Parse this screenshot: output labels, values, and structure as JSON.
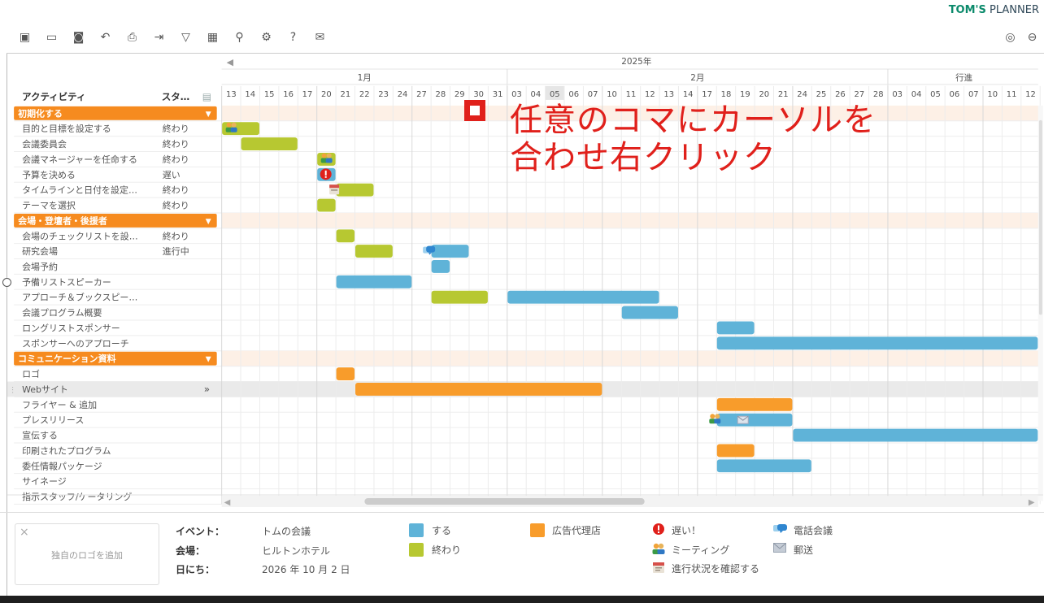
{
  "brand": {
    "bold": "TOM'S",
    "rest": " PLANNER"
  },
  "toolbar": {
    "icons": [
      "new-file-icon",
      "folder-icon",
      "save-icon",
      "undo-icon",
      "print-icon",
      "export-icon",
      "filter-icon",
      "calendar-view-icon",
      "search-icon",
      "settings-icon",
      "help-icon",
      "mail-icon"
    ],
    "glyphs": [
      "▣",
      "▭",
      "◙",
      "↶",
      "⎙",
      "⇥",
      "▽",
      "▦",
      "⚲",
      "⚙",
      "?",
      "✉"
    ],
    "right_icons": [
      "user-icon",
      "logout-icon"
    ],
    "right_glyphs": [
      "◎",
      "⊖"
    ]
  },
  "header": {
    "activity_label": "アクティビティ",
    "status_label": "スタ…",
    "year": "2025年",
    "months": [
      "1月",
      "2月",
      "行進"
    ],
    "days": [
      "13",
      "14",
      "15",
      "16",
      "17",
      "20",
      "21",
      "22",
      "23",
      "24",
      "27",
      "28",
      "29",
      "30",
      "31",
      "03",
      "04",
      "05",
      "06",
      "07",
      "10",
      "11",
      "12",
      "13",
      "14",
      "17",
      "18",
      "19",
      "20",
      "21",
      "24",
      "25",
      "26",
      "27",
      "28",
      "03",
      "04",
      "05",
      "06",
      "07",
      "10",
      "11",
      "12"
    ],
    "highlight_day_index": 17
  },
  "colors": {
    "orange": "#f89c2b",
    "green": "#b7c831",
    "blue": "#5fb3d8",
    "group_bg": "#f68b1f",
    "red": "#e0201b"
  },
  "rows": [
    {
      "type": "group",
      "label": "初期化する"
    },
    {
      "type": "task",
      "label": "目的と目標を設定する",
      "status": "終わり",
      "bars": [
        {
          "start": 0,
          "len": 2,
          "color": "green",
          "icon": "meeting"
        }
      ]
    },
    {
      "type": "task",
      "label": "会議委員会",
      "status": "終わり",
      "bars": [
        {
          "start": 1,
          "len": 3,
          "color": "green"
        }
      ]
    },
    {
      "type": "task",
      "label": "会議マネージャーを任命する",
      "status": "終わり",
      "bars": [
        {
          "start": 5,
          "len": 1,
          "color": "green",
          "icon": "meeting"
        }
      ]
    },
    {
      "type": "task",
      "label": "予算を決める",
      "status": "遅い",
      "bars": [
        {
          "start": 5,
          "len": 1,
          "color": "blue",
          "icon": "late"
        }
      ]
    },
    {
      "type": "task",
      "label": "タイムラインと日付を設定…",
      "status": "終わり",
      "bars": [
        {
          "start": 6,
          "len": 2,
          "color": "green",
          "icon": "progress"
        }
      ]
    },
    {
      "type": "task",
      "label": "テーマを選択",
      "status": "終わり",
      "bars": [
        {
          "start": 5,
          "len": 1,
          "color": "green"
        }
      ]
    },
    {
      "type": "group",
      "label": "会場・登壇者・後援者"
    },
    {
      "type": "task",
      "label": "会場のチェックリストを設…",
      "status": "終わり",
      "bars": [
        {
          "start": 6,
          "len": 1,
          "color": "green"
        }
      ]
    },
    {
      "type": "task",
      "label": "研究会場",
      "status": "進行中",
      "bars": [
        {
          "start": 7,
          "len": 2,
          "color": "green"
        },
        {
          "start": 11,
          "len": 2,
          "color": "blue",
          "icon": "call"
        }
      ]
    },
    {
      "type": "task",
      "label": "会場予約",
      "status": "",
      "bars": [
        {
          "start": 11,
          "len": 1,
          "color": "blue"
        }
      ]
    },
    {
      "type": "task",
      "label": "予備リストスピーカー",
      "status": "",
      "bars": [
        {
          "start": 6,
          "len": 4,
          "color": "blue"
        }
      ]
    },
    {
      "type": "task",
      "label": "アプローチ＆ブックスピー…",
      "status": "",
      "bars": [
        {
          "start": 11,
          "len": 3,
          "color": "green"
        },
        {
          "start": 15,
          "len": 8,
          "color": "blue"
        }
      ]
    },
    {
      "type": "task",
      "label": "会議プログラム概要",
      "status": "",
      "bars": [
        {
          "start": 21,
          "len": 3,
          "color": "blue"
        }
      ]
    },
    {
      "type": "task",
      "label": "ロングリストスポンサー",
      "status": "",
      "bars": [
        {
          "start": 26,
          "len": 2,
          "color": "blue"
        }
      ]
    },
    {
      "type": "task",
      "label": "スポンサーへのアプローチ",
      "status": "",
      "bars": [
        {
          "start": 26,
          "len": 17,
          "color": "blue"
        }
      ]
    },
    {
      "type": "group",
      "label": "コミュニケーション資料"
    },
    {
      "type": "task",
      "label": "ロゴ",
      "status": "",
      "bars": [
        {
          "start": 6,
          "len": 1,
          "color": "orange"
        }
      ]
    },
    {
      "type": "task",
      "label": "Webサイト",
      "status": "",
      "selected": true,
      "more": "»",
      "bars": [
        {
          "start": 7,
          "len": 13,
          "color": "orange"
        }
      ]
    },
    {
      "type": "task",
      "label": "フライヤー & 追加",
      "status": "",
      "bars": [
        {
          "start": 26,
          "len": 4,
          "color": "orange"
        }
      ]
    },
    {
      "type": "task",
      "label": "プレスリリース",
      "status": "",
      "bars": [
        {
          "start": 26,
          "len": 4,
          "color": "blue",
          "icon": "meeting-mail"
        }
      ]
    },
    {
      "type": "task",
      "label": "宣伝する",
      "status": "",
      "bars": [
        {
          "start": 30,
          "len": 13,
          "color": "blue"
        }
      ]
    },
    {
      "type": "task",
      "label": "印刷されたプログラム",
      "status": "",
      "bars": [
        {
          "start": 26,
          "len": 2,
          "color": "orange"
        }
      ]
    },
    {
      "type": "task",
      "label": "委任情報パッケージ",
      "status": "",
      "bars": [
        {
          "start": 26,
          "len": 5,
          "color": "blue"
        }
      ]
    },
    {
      "type": "task",
      "label": "サイネージ",
      "status": "",
      "bars": []
    },
    {
      "type": "task",
      "label": "指示スタッフ/ケータリング",
      "status": "",
      "bars": []
    }
  ],
  "annotation": {
    "line1": "任意のコマにカーソルを",
    "line2": "合わせ右クリック"
  },
  "legend": {
    "logo_close": "×",
    "logo_text": "独自のロゴを追加",
    "event_key": "イベント：",
    "event_value": "トムの会議",
    "venue_key": "会場：",
    "venue_value": "ヒルトンホテル",
    "date_key": "日にち：",
    "date_value": "2026 年 10 月 2 日",
    "do_label": "する",
    "done_label": "終わり",
    "agency_label": "広告代理店",
    "late_label": "遅い！",
    "meeting_label": "ミーティング",
    "progress_label": "進行状況を確認する",
    "call_label": "電話会議",
    "mail_label": "郵送"
  }
}
